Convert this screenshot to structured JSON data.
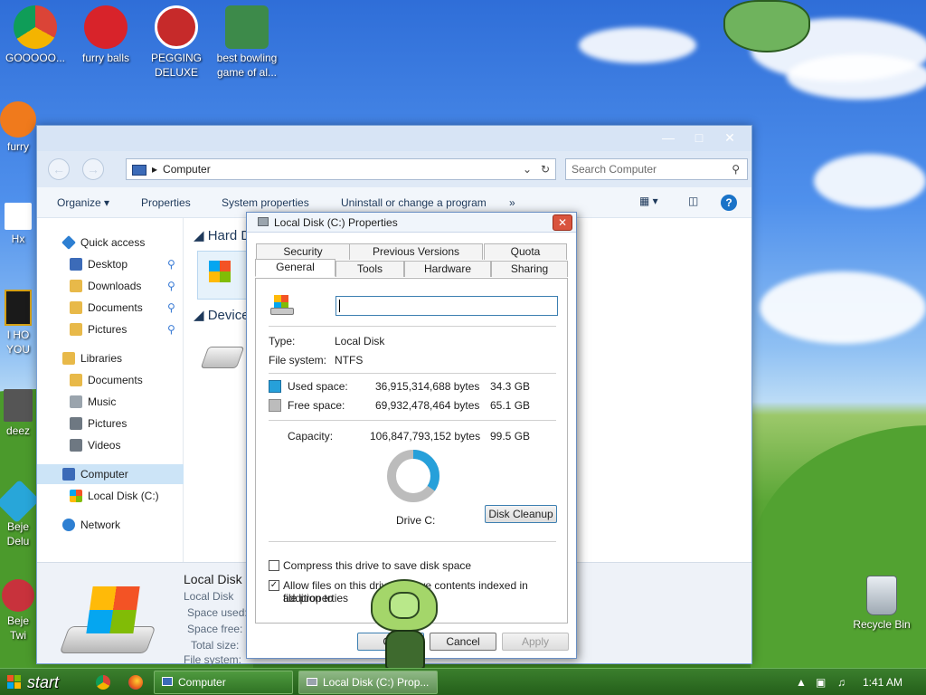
{
  "desktop": {
    "icons": [
      {
        "label": "GOOOOO...",
        "color": "#d23b2b"
      },
      {
        "label": "furry balls",
        "color": "#d8232a"
      },
      {
        "label": "PEGGING DELUXE",
        "color": "#c62a2a"
      },
      {
        "label": "best bowling game of al...",
        "color": "#3d8a4a"
      },
      {
        "label": "furry",
        "color": "#f07a1c"
      },
      {
        "label": "Hx",
        "color": "#1d5e9b"
      },
      {
        "label": "I HO YOU",
        "color": "#d4a015"
      },
      {
        "label": "deez",
        "color": "#555555"
      },
      {
        "label": "Beje Delu",
        "color": "#28a6d9"
      },
      {
        "label": "Beje Twi",
        "color": "#c8323c"
      }
    ],
    "recycle_bin": "Recycle Bin"
  },
  "explorer": {
    "address": "Computer",
    "search_placeholder": "Search Computer",
    "toolbar": [
      "Organize",
      "Properties",
      "System properties",
      "Uninstall or change a program",
      "»"
    ],
    "nav": {
      "quick_access": "Quick access",
      "quick_items": [
        "Desktop",
        "Downloads",
        "Documents",
        "Pictures"
      ],
      "libraries": "Libraries",
      "library_items": [
        "Documents",
        "Music",
        "Pictures",
        "Videos"
      ],
      "computer": "Computer",
      "local_disk": "Local Disk (C:)",
      "network": "Network"
    },
    "content": {
      "group1": "Hard D",
      "group2": "Device"
    },
    "details": {
      "name": "Local Disk (",
      "type": "Local Disk",
      "labels": [
        "Space used:",
        "Space free:",
        "Total size:",
        "File system:"
      ]
    }
  },
  "dialog": {
    "title": "Local Disk (C:) Properties",
    "tabs_top": [
      "Security",
      "Previous Versions",
      "Quota"
    ],
    "tabs_bottom": [
      "General",
      "Tools",
      "Hardware",
      "Sharing"
    ],
    "type_label": "Type:",
    "type_value": "Local Disk",
    "fs_label": "File system:",
    "fs_value": "NTFS",
    "used_label": "Used space:",
    "used_bytes": "36,915,314,688 bytes",
    "used_gb": "34.3 GB",
    "free_label": "Free space:",
    "free_bytes": "69,932,478,464 bytes",
    "free_gb": "65.1 GB",
    "cap_label": "Capacity:",
    "cap_bytes": "106,847,793,152 bytes",
    "cap_gb": "99.5 GB",
    "used_fraction": 0.3455,
    "used_color": "#26a0da",
    "free_color": "#bcbcbc",
    "drive_label": "Drive C:",
    "cleanup": "Disk Cleanup",
    "compress": "Compress this drive to save disk space",
    "index_line1": "Allow files on this drive to have contents indexed in addition to",
    "index_line2": "file properties",
    "ok": "OK",
    "cancel": "Cancel",
    "apply": "Apply"
  },
  "taskbar": {
    "start": "start",
    "tasks": [
      "Computer",
      "Local Disk (C:) Prop..."
    ],
    "clock": "1:41 AM"
  }
}
